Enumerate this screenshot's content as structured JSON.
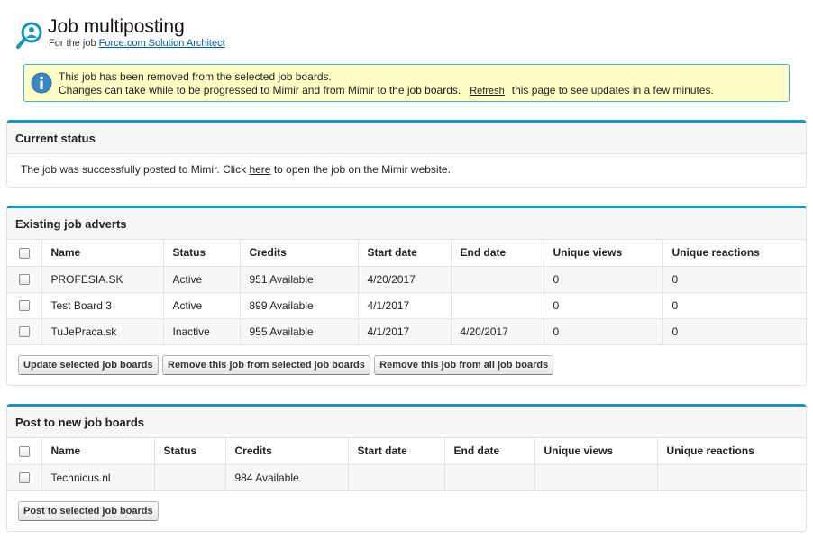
{
  "header": {
    "title": "Job multiposting",
    "subtitle_prefix": "For the job",
    "job_link": "Force.com Solution Architect"
  },
  "info": {
    "line1": "This job has been removed from the selected job boards.",
    "line2_before": "Changes can take while to be progressed to Mimir and from Mimir to the job boards.",
    "refresh_link": "Refresh",
    "line2_after": "this page to see updates in a few minutes."
  },
  "current_status": {
    "heading": "Current status",
    "text_before": "The job was successfully posted to Mimir. Click",
    "link": "here",
    "text_after": "to open the job on the Mimir website."
  },
  "existing": {
    "heading": "Existing job adverts",
    "columns": [
      "Name",
      "Status",
      "Credits",
      "Start date",
      "End date",
      "Unique views",
      "Unique reactions"
    ],
    "rows": [
      {
        "name": "PROFESIA.SK",
        "status": "Active",
        "credits": "951 Available",
        "start": "4/20/2017",
        "end": "",
        "views": "0",
        "reactions": "0"
      },
      {
        "name": "Test Board 3",
        "status": "Active",
        "credits": "899 Available",
        "start": "4/1/2017",
        "end": "",
        "views": "0",
        "reactions": "0"
      },
      {
        "name": "TuJePraca.sk",
        "status": "Inactive",
        "credits": "955 Available",
        "start": "4/1/2017",
        "end": "4/20/2017",
        "views": "0",
        "reactions": "0"
      }
    ],
    "buttons": {
      "update": "Update selected job boards",
      "remove_selected": "Remove this job from selected job boards",
      "remove_all": "Remove this job from all job boards"
    }
  },
  "post_new": {
    "heading": "Post to new job boards",
    "columns": [
      "Name",
      "Status",
      "Credits",
      "Start date",
      "End date",
      "Unique views",
      "Unique reactions"
    ],
    "rows": [
      {
        "name": "Technicus.nl",
        "status": "",
        "credits": "984 Available",
        "start": "",
        "end": "",
        "views": "",
        "reactions": ""
      }
    ],
    "buttons": {
      "post": "Post to selected job boards"
    }
  },
  "colors": {
    "accent": "#1797c0",
    "info_bg": "#ffffc5",
    "info_border": "#39b3d7",
    "link": "#015ba7"
  },
  "icons": {
    "logo": "person-search-icon",
    "info": "info-icon"
  }
}
